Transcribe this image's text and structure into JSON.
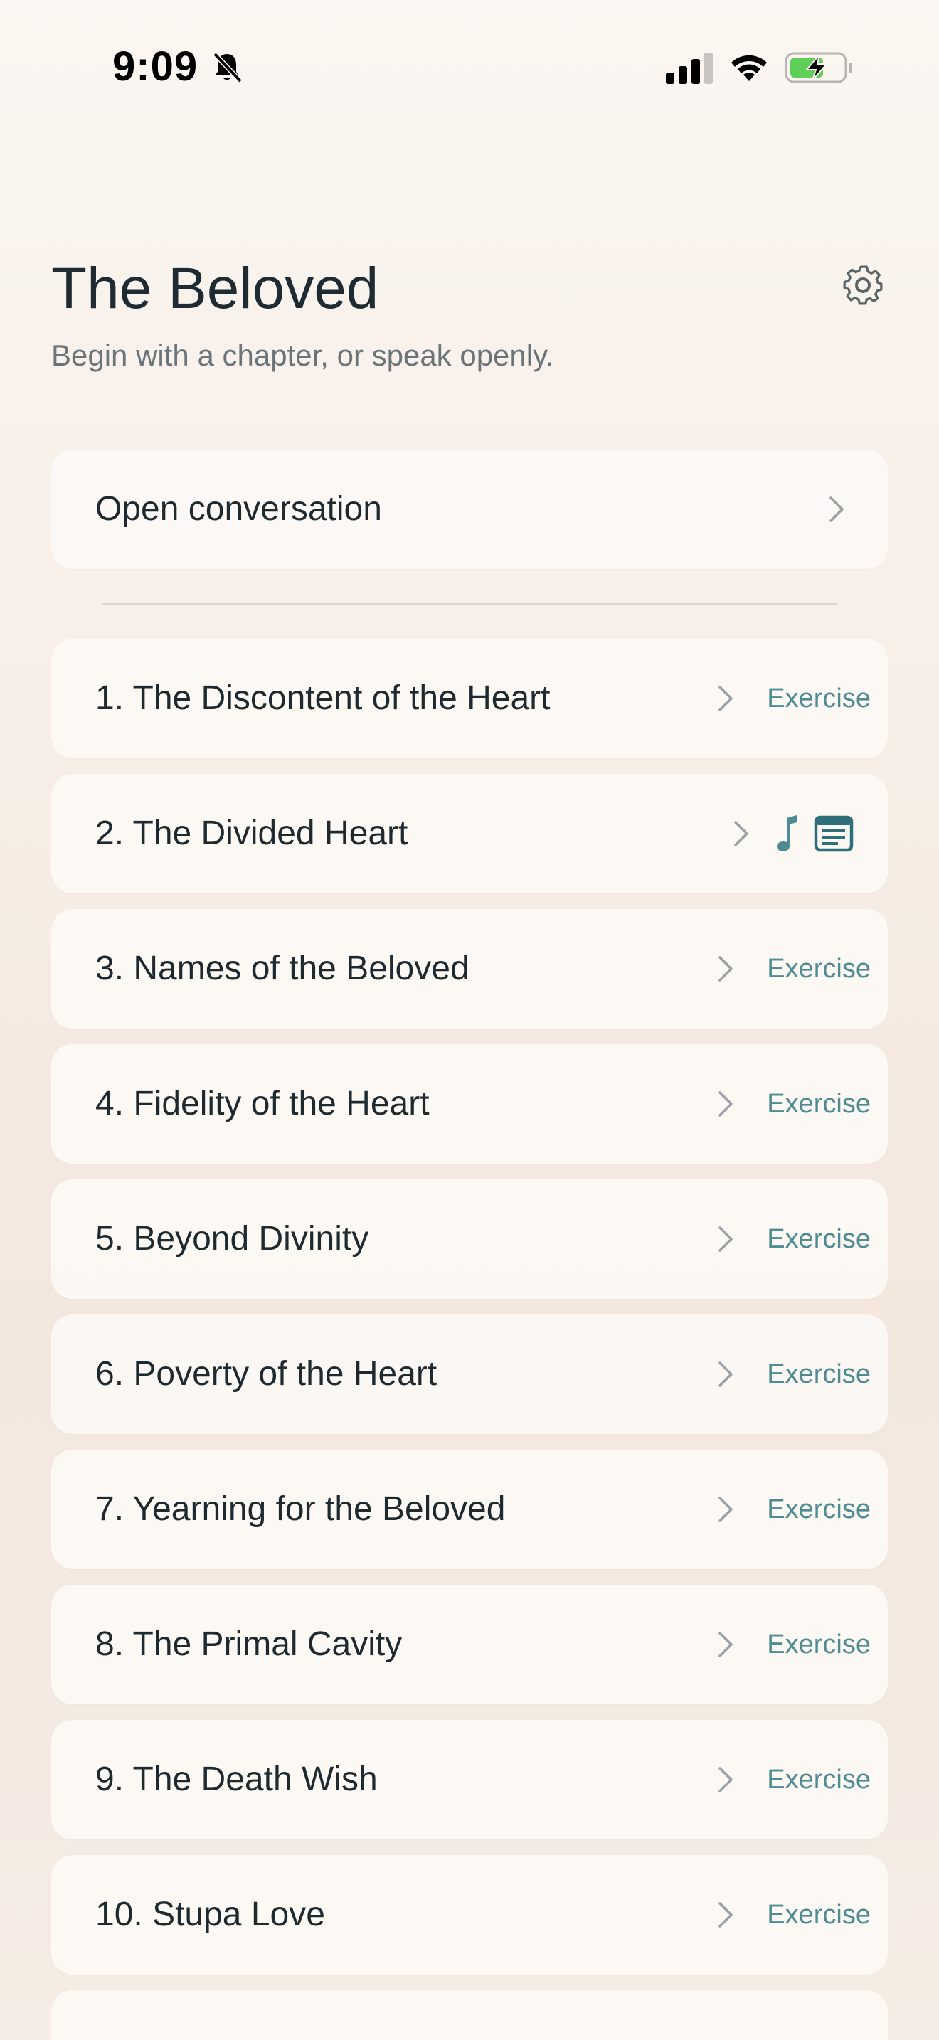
{
  "status_bar": {
    "time": "9:09",
    "icons": [
      "bell-slash-icon",
      "cellular-signal-icon",
      "wifi-icon",
      "battery-charging-icon"
    ]
  },
  "header": {
    "title": "The Beloved",
    "subtitle": "Begin with a chapter, or speak openly.",
    "settings_icon": "gear-icon"
  },
  "open_conversation": {
    "label": "Open conversation"
  },
  "chapters": [
    {
      "label": "1. The Discontent of the Heart",
      "action": "Exercise"
    },
    {
      "label": "2. The Divided Heart",
      "action": null,
      "icons": [
        "music-note-icon",
        "document-icon"
      ]
    },
    {
      "label": "3. Names of the Beloved",
      "action": "Exercise"
    },
    {
      "label": "4. Fidelity of the Heart",
      "action": "Exercise"
    },
    {
      "label": "5. Beyond Divinity",
      "action": "Exercise"
    },
    {
      "label": "6. Poverty of the Heart",
      "action": "Exercise"
    },
    {
      "label": "7. Yearning for the Beloved",
      "action": "Exercise"
    },
    {
      "label": "8. The Primal Cavity",
      "action": "Exercise"
    },
    {
      "label": "9. The Death Wish",
      "action": "Exercise"
    },
    {
      "label": "10. Stupa Love",
      "action": "Exercise"
    }
  ],
  "colors": {
    "accent": "#4f8b92",
    "icon_dark": "#2f6f7a",
    "title_text": "#1e2b33",
    "subtitle_text": "#6b7479",
    "battery_green": "#5fcf5a"
  }
}
